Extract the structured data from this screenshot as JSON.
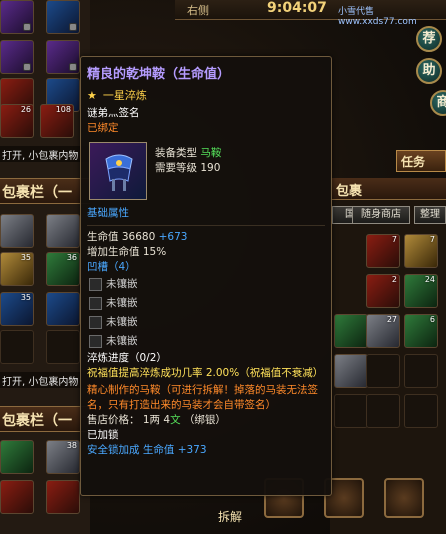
{
  "topbar": {
    "name": "右侧",
    "time": "9:04:07",
    "watermark": "小雪代售www.xxds77.com"
  },
  "round_buttons": [
    "荐",
    "助",
    "商"
  ],
  "left_panel": {
    "bag_label_1": "包裹栏（一",
    "bag_label_2": "包裹栏（一",
    "hint_1": "打开, 小包裹内物",
    "hint_2": "打开, 小包裹内物",
    "counts": [
      "26",
      "108",
      "35",
      "36",
      "35",
      "38"
    ]
  },
  "task_button": "任务",
  "right_panel": {
    "header": "包裹",
    "tabs": [
      "国家",
      "随身商店",
      "整理"
    ],
    "counts": [
      "7",
      "7",
      "2",
      "24",
      "27",
      "6",
      "2",
      "5"
    ]
  },
  "bottom": {
    "dismantle_label": "拆解"
  },
  "tooltip": {
    "title": "精良的乾坤鞍（生命值）",
    "refine_level": "一星淬炼",
    "owner": "谜弟灬签名",
    "bound": "已绑定",
    "equip_type_label": "装备类型",
    "equip_type_value": "马鞍",
    "req_level_label": "需要等级",
    "req_level_value": "190",
    "base_attr_title": "基础属性",
    "hp_label": "生命值",
    "hp_value": "36680",
    "hp_bonus": "+673",
    "hp_pct": "增加生命值 15%",
    "socket_title": "凹槽（4）",
    "sockets": [
      "未镶嵌",
      "未镶嵌",
      "未镶嵌",
      "未镶嵌"
    ],
    "refine_progress": "淬炼进度（0/2）",
    "bless_text": "祝福值提高淬炼成功几率 2.00%（祝福值不衰减）",
    "desc": "精心制作的马鞍（可进行拆解！掉落的马装无法签名，只有打造出来的马装才会自带签名）",
    "price_label": "售店价格：",
    "price_liang": "1",
    "price_liang_unit": "两",
    "price_wen": "4",
    "price_wen_unit": "文",
    "price_bound": "（绑银）",
    "locked": "已加锁",
    "lock_bonus_label": "安全锁加成",
    "lock_bonus_stat": "生命值",
    "lock_bonus_value": "+373"
  },
  "colors": {
    "title": "#b59cff",
    "refine": "#ffd24a",
    "bound": "#ff8a2a",
    "green": "#55e05a",
    "blue": "#4aa8ff"
  }
}
